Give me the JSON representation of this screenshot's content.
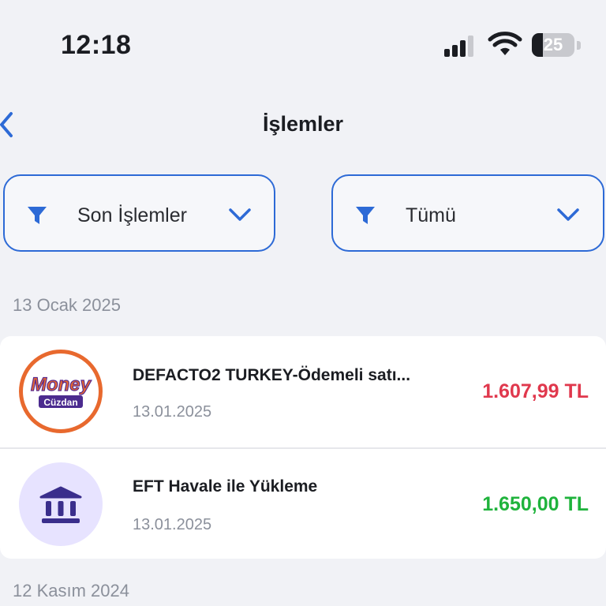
{
  "status_bar": {
    "time": "12:18",
    "battery_level": "25",
    "icons": [
      "signal-icon",
      "wifi-icon",
      "battery-icon"
    ]
  },
  "header": {
    "title": "İşlemler",
    "back_icon": "chevron-left-icon"
  },
  "filters": [
    {
      "label": "Son İşlemler",
      "icon": "filter-funnel-icon",
      "dropdown_icon": "chevron-down-icon"
    },
    {
      "label": "Tümü",
      "icon": "filter-funnel-icon",
      "dropdown_icon": "chevron-down-icon"
    }
  ],
  "groups": [
    {
      "date": "13 Ocak 2025",
      "transactions": [
        {
          "title": "DEFACTO2 TURKEY-Ödemeli satı...",
          "date": "13.01.2025",
          "amount": "1.607,99 TL",
          "type": "debit",
          "logo": {
            "line1": "Money",
            "line2": "Cüzdan"
          }
        },
        {
          "title": "EFT Havale ile Yükleme",
          "date": "13.01.2025",
          "amount": "1.650,00 TL",
          "type": "credit",
          "icon": "bank-icon"
        }
      ]
    },
    {
      "date": "12 Kasım 2024",
      "transactions": []
    }
  ],
  "colors": {
    "accent": "#2D6AD6",
    "debit": "#E0384D",
    "credit": "#1FB33C",
    "background": "#F1F2F6",
    "muted": "#8B909B"
  }
}
